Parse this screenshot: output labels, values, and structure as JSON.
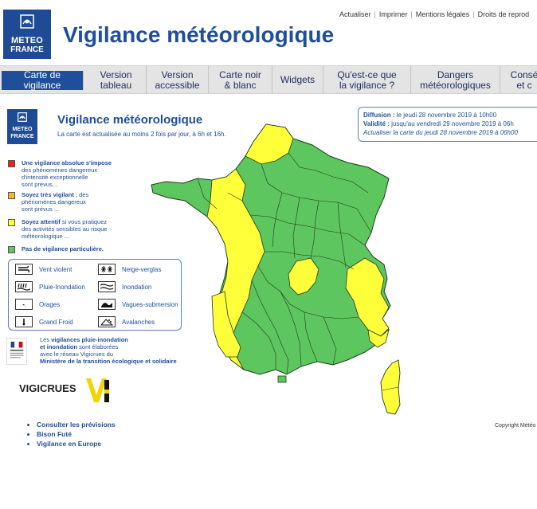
{
  "header": {
    "logo_line1": "METEO",
    "logo_line2": "FRANCE",
    "title": "Vigilance météorologique",
    "links": [
      "Actualiser",
      "Imprimer",
      "Mentions légales",
      "Droits de reprod"
    ]
  },
  "nav": {
    "items": [
      {
        "label": "Carte de vigilance",
        "active": true
      },
      {
        "label": "Version\ntableau"
      },
      {
        "label": "Version\naccessible"
      },
      {
        "label": "Carte noir\n& blanc"
      },
      {
        "label": "Widgets"
      },
      {
        "label": "Qu'est-ce que\nla vigilance ?"
      },
      {
        "label": "Dangers\nmétéorologiques"
      },
      {
        "label": "Consé\net c"
      }
    ]
  },
  "content": {
    "logo_line1": "METEO",
    "logo_line2": "FRANCE",
    "title": "Vigilance météorologique",
    "subtitle": "La carte est actualisée au moins 2 fois par jour, à 6h et 16h."
  },
  "diffusion": {
    "diffusion_label": "Diffusion :",
    "diffusion_value": " le jeudi 28 novembre 2019 à 10h00",
    "validite_label": "Validité :",
    "validite_value": " jusqu'au vendredi 29 novembre 2019 à 06h",
    "update_link": "Actualiser la carte du jeudi 28 novembre 2019 à 06h00"
  },
  "legend": {
    "red_bold": "Une vigilance absolue s'impose",
    "red_line2": "des phénomènes dangereux",
    "red_line3": "d'intensité exceptionnelle",
    "red_line4": "sont prévus...",
    "orange_bold": "Soyez très vigilant",
    "orange_rest": " , des",
    "orange_line2": "phénomènes dangereux",
    "orange_line3": "sont prévus ...",
    "yellow_bold": "Soyez attentif",
    "yellow_rest": " si vous pratiquez",
    "yellow_line2": "des activités sensibles au risque",
    "yellow_line3": "météorologique ...",
    "green_bold": "Pas de vigilance particulière.",
    "colors": {
      "red": "#e8221c",
      "orange": "#f5b52e",
      "yellow": "#ffff3a",
      "green": "#5ec65e"
    }
  },
  "phenomena": {
    "vent": "Vent violent",
    "neige": "Neige-verglas",
    "pluie": "Pluie-Inondation",
    "inondation": "Inondation",
    "orages": "Orages",
    "vagues": "Vagues-submersion",
    "froid": "Grand Froid",
    "avalanches": "Avalanches"
  },
  "ministry": {
    "line1_a": "Les ",
    "line1_b": "vigilances pluie-inondation",
    "line2": "et inondation",
    "line2_rest": " sont élaborées",
    "line3": "avec le réseau Vigicrues du",
    "line4": "Ministère de la transition écologique et solidaire"
  },
  "vigicrues": {
    "label": "VIGICRUES"
  },
  "links": {
    "items": [
      "Consulter les prévisions",
      "Bison Futé",
      "Vigilance en Europe"
    ]
  },
  "copyright": "Copyright Météo"
}
